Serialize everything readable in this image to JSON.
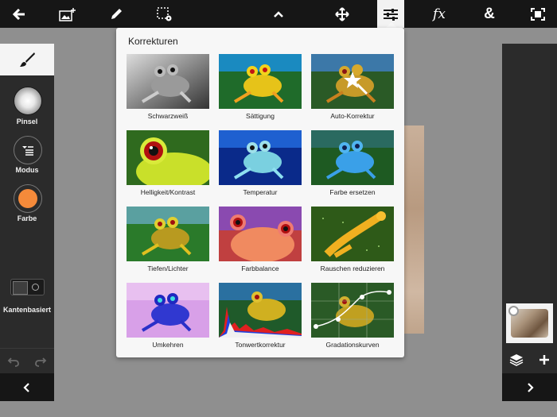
{
  "toolbar": {
    "icons": [
      "back-arrow-icon",
      "add-image-icon",
      "pencil-icon",
      "selection-gear-icon",
      "chevron-up-icon",
      "move-icon",
      "sliders-icon",
      "fx-icon",
      "ampersand-icon",
      "fit-screen-icon"
    ],
    "fx_label": "fx",
    "amp_label": "&"
  },
  "left_panel": {
    "brush_label": "Pinsel",
    "mode_label": "Modus",
    "color_label": "Farbe",
    "edge_label": "Kantenbasiert",
    "current_color": "#f58a3a"
  },
  "popover": {
    "title": "Korrekturen",
    "items": [
      {
        "label": "Schwarzweiß"
      },
      {
        "label": "Sättigung"
      },
      {
        "label": "Auto-Korrektur"
      },
      {
        "label": "Helligkeit/Kontrast"
      },
      {
        "label": "Temperatur"
      },
      {
        "label": "Farbe ersetzen"
      },
      {
        "label": "Tiefen/Lichter"
      },
      {
        "label": "Farbbalance"
      },
      {
        "label": "Rauschen reduzieren"
      },
      {
        "label": "Umkehren"
      },
      {
        "label": "Tonwertkorrektur"
      },
      {
        "label": "Gradationskurven"
      }
    ]
  }
}
